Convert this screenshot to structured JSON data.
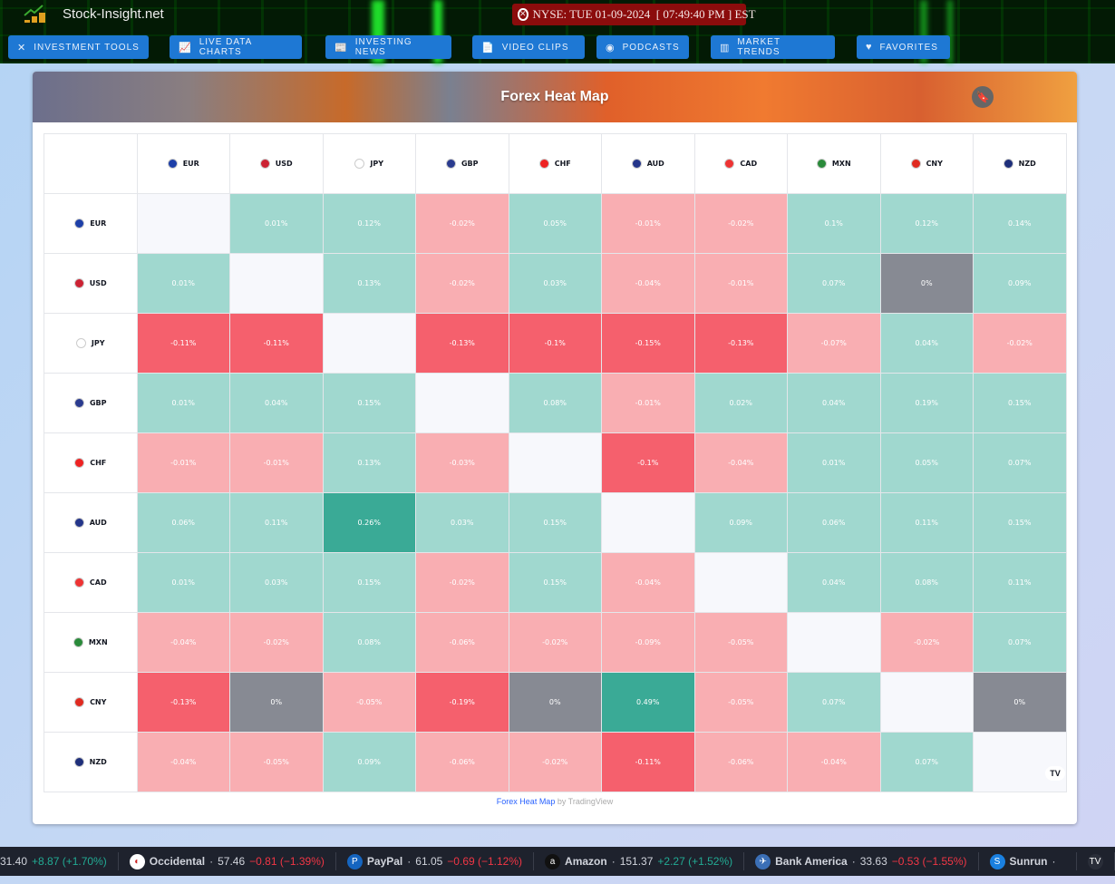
{
  "header": {
    "site_name": "Stock-Insight.net",
    "clock": "NYSE: TUE 01-09-2024  [ 07:49:40 PM ] EST",
    "nav": [
      {
        "label": "INVESTMENT TOOLS",
        "icon": "tools-icon"
      },
      {
        "label": "LIVE DATA CHARTS",
        "icon": "chart-icon"
      },
      {
        "label": "INVESTING NEWS",
        "icon": "news-icon"
      },
      {
        "label": "VIDEO CLIPS",
        "icon": "video-icon"
      },
      {
        "label": "PODCASTS",
        "icon": "podcast-icon"
      },
      {
        "label": "MARKET TRENDS",
        "icon": "bar-chart-icon"
      },
      {
        "label": "FAVORITES",
        "icon": "heart-icon"
      }
    ]
  },
  "widget": {
    "title": "Forex Heat Map",
    "credit_link": "Forex Heat Map",
    "credit_suffix": " by TradingView",
    "logo": "TV"
  },
  "colors": {
    "light_green": "#a0d8cf",
    "dark_green": "#3aaa96",
    "light_red": "#f9aeb2",
    "dark_red": "#f5606d",
    "neutral": "#878a93"
  },
  "currencies": [
    "EUR",
    "USD",
    "JPY",
    "GBP",
    "CHF",
    "AUD",
    "CAD",
    "MXN",
    "CNY",
    "NZD"
  ],
  "matrix": [
    [
      "",
      "0.01%",
      "0.12%",
      "-0.02%",
      "0.05%",
      "-0.01%",
      "-0.02%",
      "0.1%",
      "0.12%",
      "0.14%"
    ],
    [
      "0.01%",
      "",
      "0.13%",
      "-0.02%",
      "0.03%",
      "-0.04%",
      "-0.01%",
      "0.07%",
      "0%",
      "0.09%"
    ],
    [
      "-0.11%",
      "-0.11%",
      "",
      "-0.13%",
      "-0.1%",
      "-0.15%",
      "-0.13%",
      "-0.07%",
      "0.04%",
      "-0.02%"
    ],
    [
      "0.01%",
      "0.04%",
      "0.15%",
      "",
      "0.08%",
      "-0.01%",
      "0.02%",
      "0.04%",
      "0.19%",
      "0.15%"
    ],
    [
      "-0.01%",
      "-0.01%",
      "0.13%",
      "-0.03%",
      "",
      "-0.1%",
      "-0.04%",
      "0.01%",
      "0.05%",
      "0.07%"
    ],
    [
      "0.06%",
      "0.11%",
      "0.26%",
      "0.03%",
      "0.15%",
      "",
      "0.09%",
      "0.06%",
      "0.11%",
      "0.15%"
    ],
    [
      "0.01%",
      "0.03%",
      "0.15%",
      "-0.02%",
      "0.15%",
      "-0.04%",
      "",
      "0.04%",
      "0.08%",
      "0.11%"
    ],
    [
      "-0.04%",
      "-0.02%",
      "0.08%",
      "-0.06%",
      "-0.02%",
      "-0.09%",
      "-0.05%",
      "",
      "-0.02%",
      "0.07%"
    ],
    [
      "-0.13%",
      "0%",
      "-0.05%",
      "-0.19%",
      "0%",
      "0.49%",
      "-0.05%",
      "0.07%",
      "",
      "0%"
    ],
    [
      "-0.04%",
      "-0.05%",
      "0.09%",
      "-0.06%",
      "-0.02%",
      "-0.11%",
      "-0.06%",
      "-0.04%",
      "0.07%",
      ""
    ]
  ],
  "ticker": [
    {
      "name": "",
      "price": "31.40",
      "change": "+8.87 (+1.70%)",
      "dir": "up"
    },
    {
      "name": "Occidental",
      "price": "57.46",
      "change": "−0.81 (−1.39%)",
      "dir": "dn"
    },
    {
      "name": "PayPal",
      "price": "61.05",
      "change": "−0.69 (−1.12%)",
      "dir": "dn"
    },
    {
      "name": "Amazon",
      "price": "151.37",
      "change": "+2.27 (+1.52%)",
      "dir": "up"
    },
    {
      "name": "Bank America",
      "price": "33.63",
      "change": "−0.53 (−1.55%)",
      "dir": "dn"
    },
    {
      "name": "Sunrun",
      "price": "",
      "change": "",
      "dir": "up"
    }
  ]
}
